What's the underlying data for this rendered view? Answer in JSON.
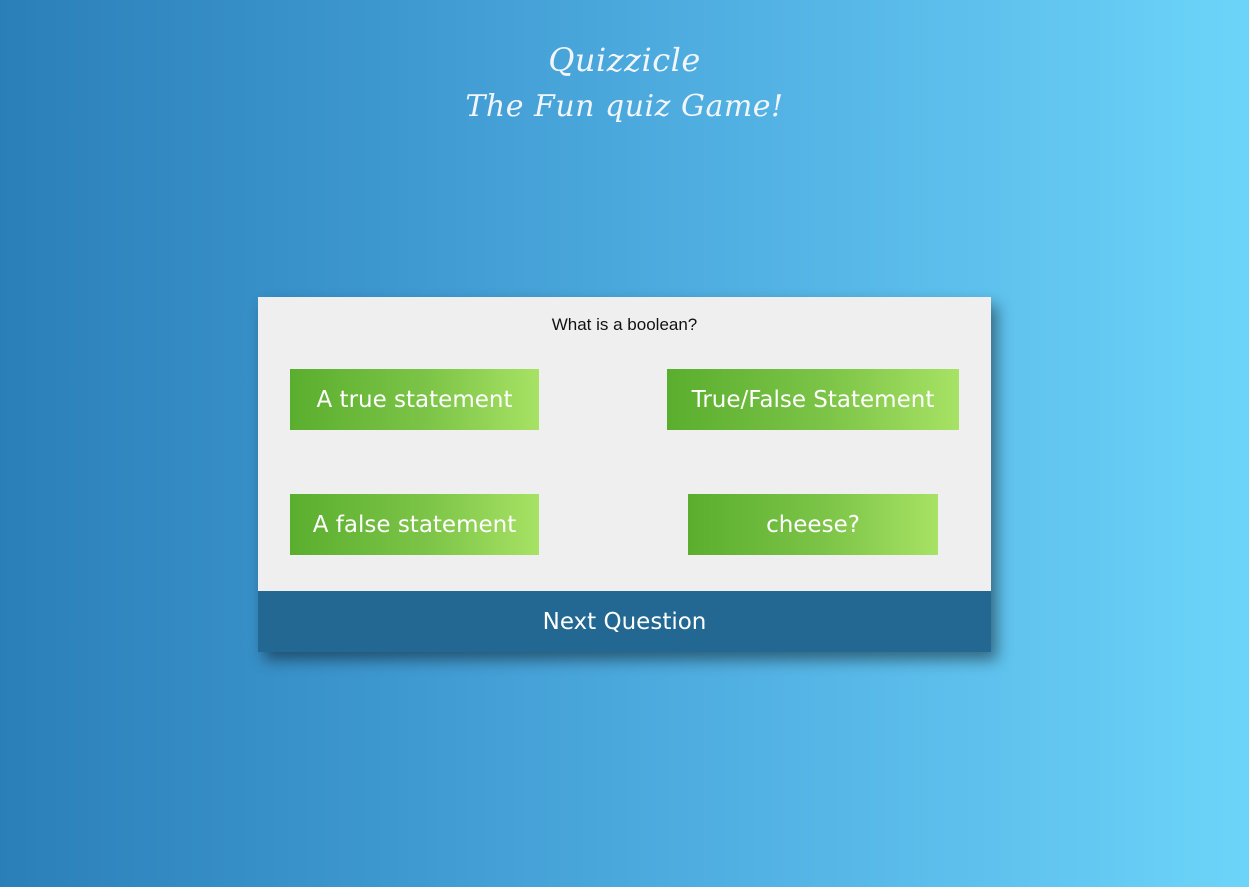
{
  "header": {
    "title": "Quizzicle",
    "subtitle": "The Fun quiz Game!"
  },
  "quiz": {
    "question": "What is a boolean?",
    "answers": [
      "A true statement",
      "True/False Statement",
      "A false statement",
      "cheese?"
    ],
    "next_label": "Next Question"
  },
  "colors": {
    "background_left": "#2b7fb9",
    "background_right": "#6cd4f9",
    "card": "#efefef",
    "answer_green_left": "#5aae2e",
    "answer_green_right": "#a7e264",
    "next_button": "#226893"
  }
}
